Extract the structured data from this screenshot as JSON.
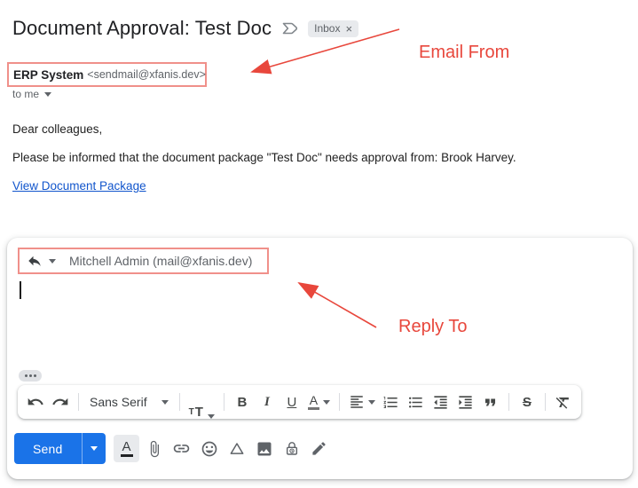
{
  "header": {
    "subject": "Document Approval: Test Doc",
    "inbox_label": "Inbox",
    "inbox_close": "×"
  },
  "sender": {
    "name": "ERP System",
    "email": "<sendmail@xfanis.dev>",
    "recipient_row": "to me"
  },
  "body": {
    "greeting": "Dear colleagues,",
    "message": "Please be informed that the document package \"Test Doc\" needs approval from: Brook Harvey.",
    "link_text": "View Document Package"
  },
  "annotations": {
    "email_from_label": "Email From",
    "reply_to_label": "Reply To",
    "annotation_color": "#e8473c",
    "highlight_box_color": "#f0908a"
  },
  "compose": {
    "reply_to_value": "Mitchell Admin (mail@xfanis.dev)",
    "send_button": "Send",
    "toolbar": {
      "font_family_label": "Sans Serif",
      "size_small": "T",
      "size_large": "T",
      "bold_label": "B",
      "italic_label": "I",
      "underline_label": "U",
      "text_color_label": "A",
      "strikethrough_label": "S"
    },
    "formatting_toggle_label": "A"
  },
  "colors": {
    "accent_blue": "#1a73e8",
    "link_blue": "#1155cc",
    "text_primary": "#202124",
    "text_secondary": "#5f6368",
    "chip_bg": "#e8eaed"
  }
}
